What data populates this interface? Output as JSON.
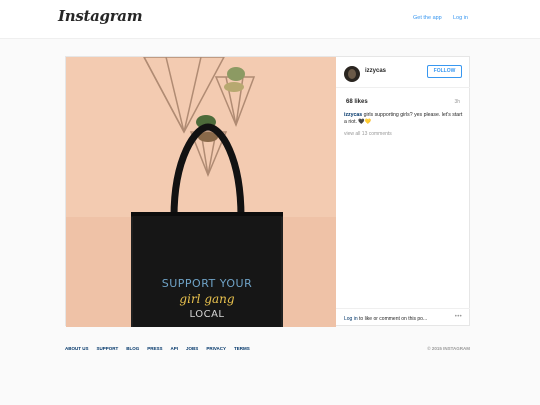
{
  "header": {
    "logo_text": "Instagram",
    "get_app_label": "Get the app",
    "login_label": "Log in"
  },
  "post": {
    "username": "izzycas",
    "follow_label": "FOLLOW",
    "likes": "68 likes",
    "time": "3h",
    "caption_user": "izzycas",
    "caption_text": "girls supporting girls? yes please. let's start a riot. 🖤💛",
    "view_comments": "view all 13 comments",
    "login_link": "Log in",
    "login_suffix": " to like or comment on this po...",
    "options": "•••",
    "image": {
      "line1": "SUPPORT YOUR",
      "line2": "girl gang",
      "line3": "LOCAL"
    }
  },
  "footer": {
    "links": [
      "ABOUT US",
      "SUPPORT",
      "BLOG",
      "PRESS",
      "API",
      "JOBS",
      "PRIVACY",
      "TERMS"
    ],
    "copyright": "© 2015 INSTAGRAM"
  },
  "colors": {
    "link_blue": "#3897f0",
    "dark_link": "#003569",
    "photo_bg": "#f2c8ae"
  }
}
